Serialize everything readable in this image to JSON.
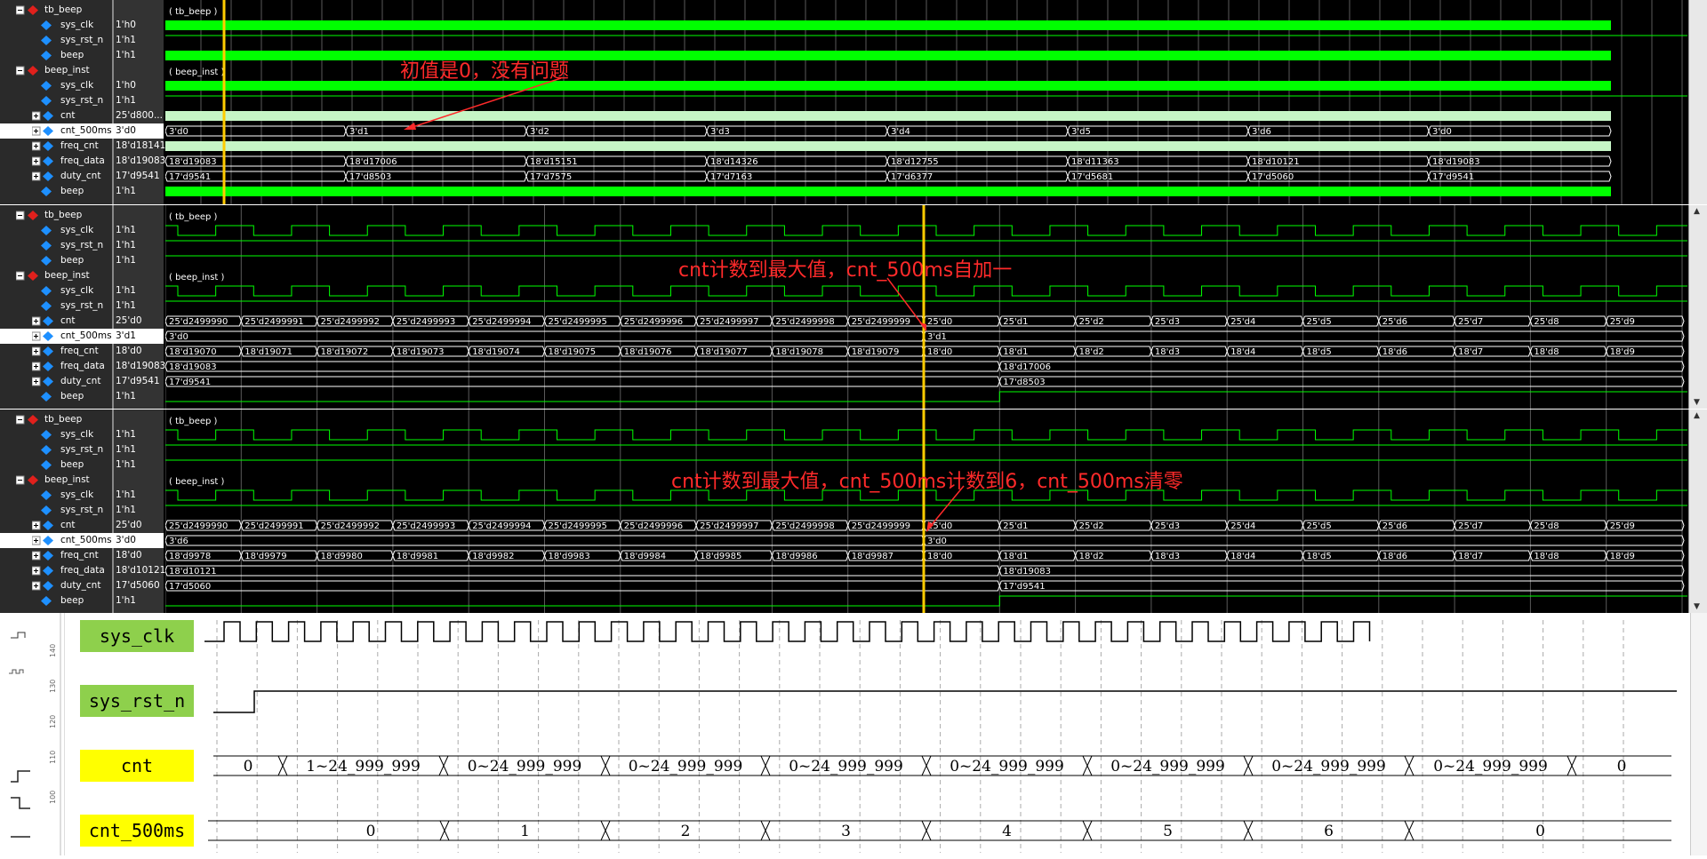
{
  "panes": [
    {
      "rows": [
        {
          "name": "tb_beep",
          "value": "",
          "level": 0,
          "kind": "group"
        },
        {
          "name": "sys_clk",
          "value": "1'h0",
          "level": 1,
          "kind": "sig"
        },
        {
          "name": "sys_rst_n",
          "value": "1'h1",
          "level": 1,
          "kind": "sig"
        },
        {
          "name": "beep",
          "value": "1'h1",
          "level": 1,
          "kind": "sig"
        },
        {
          "name": "beep_inst",
          "value": "",
          "level": 0,
          "kind": "group"
        },
        {
          "name": "sys_clk",
          "value": "1'h0",
          "level": 1,
          "kind": "sig"
        },
        {
          "name": "sys_rst_n",
          "value": "1'h1",
          "level": 1,
          "kind": "sig"
        },
        {
          "name": "cnt",
          "value": "25'd800...",
          "level": 1,
          "kind": "bus"
        },
        {
          "name": "cnt_500ms",
          "value": "3'd0",
          "level": 1,
          "kind": "bus",
          "selected": true
        },
        {
          "name": "freq_cnt",
          "value": "18'd18141",
          "level": 1,
          "kind": "bus"
        },
        {
          "name": "freq_data",
          "value": "18'd19083",
          "level": 1,
          "kind": "bus"
        },
        {
          "name": "duty_cnt",
          "value": "17'd9541",
          "level": 1,
          "kind": "bus"
        },
        {
          "name": "beep",
          "value": "1'h1",
          "level": 1,
          "kind": "sig"
        }
      ],
      "group_labels": [
        "( tb_beep )",
        "( beep_inst )"
      ],
      "cnt500_segments": [
        "3'd0",
        "3'd1",
        "3'd2",
        "3'd3",
        "3'd4",
        "3'd5",
        "3'd6",
        "3'd0"
      ],
      "freq_data_segments": [
        "18'd19083",
        "18'd17006",
        "18'd15151",
        "18'd14326",
        "18'd12755",
        "18'd11363",
        "18'd10121",
        "18'd19083"
      ],
      "duty_cnt_segments": [
        "17'd9541",
        "17'd8503",
        "17'd7575",
        "17'd7163",
        "17'd6377",
        "17'd5681",
        "17'd5060",
        "17'd9541"
      ],
      "annotation": "初值是0，没有问题"
    },
    {
      "rows": [
        {
          "name": "tb_beep",
          "value": "",
          "level": 0,
          "kind": "group"
        },
        {
          "name": "sys_clk",
          "value": "1'h1",
          "level": 1,
          "kind": "sig"
        },
        {
          "name": "sys_rst_n",
          "value": "1'h1",
          "level": 1,
          "kind": "sig"
        },
        {
          "name": "beep",
          "value": "1'h1",
          "level": 1,
          "kind": "sig"
        },
        {
          "name": "beep_inst",
          "value": "",
          "level": 0,
          "kind": "group"
        },
        {
          "name": "sys_clk",
          "value": "1'h1",
          "level": 1,
          "kind": "sig"
        },
        {
          "name": "sys_rst_n",
          "value": "1'h1",
          "level": 1,
          "kind": "sig"
        },
        {
          "name": "cnt",
          "value": "25'd0",
          "level": 1,
          "kind": "bus"
        },
        {
          "name": "cnt_500ms",
          "value": "3'd1",
          "level": 1,
          "kind": "bus",
          "selected": true
        },
        {
          "name": "freq_cnt",
          "value": "18'd0",
          "level": 1,
          "kind": "bus"
        },
        {
          "name": "freq_data",
          "value": "18'd19083",
          "level": 1,
          "kind": "bus"
        },
        {
          "name": "duty_cnt",
          "value": "17'd9541",
          "level": 1,
          "kind": "bus"
        },
        {
          "name": "beep",
          "value": "1'h1",
          "level": 1,
          "kind": "sig"
        }
      ],
      "group_labels": [
        "( tb_beep )",
        "( beep_inst )"
      ],
      "cnt_segments": [
        "25'd2499990",
        "25'd2499991",
        "25'd2499992",
        "25'd2499993",
        "25'd2499994",
        "25'd2499995",
        "25'd2499996",
        "25'd2499997",
        "25'd2499998",
        "25'd2499999",
        "25'd0",
        "25'd1",
        "25'd2",
        "25'd3",
        "25'd4",
        "25'd5",
        "25'd6",
        "25'd7",
        "25'd8",
        "25'd9"
      ],
      "cnt500_segments": [
        "3'd0",
        "3'd1"
      ],
      "freq_cnt_segments": [
        "18'd19070",
        "18'd19071",
        "18'd19072",
        "18'd19073",
        "18'd19074",
        "18'd19075",
        "18'd19076",
        "18'd19077",
        "18'd19078",
        "18'd19079",
        "18'd0",
        "18'd1",
        "18'd2",
        "18'd3",
        "18'd4",
        "18'd5",
        "18'd6",
        "18'd7",
        "18'd8",
        "18'd9"
      ],
      "freq_data_segments": [
        "18'd19083",
        "18'd17006"
      ],
      "duty_cnt_segments": [
        "17'd9541",
        "17'd8503"
      ],
      "annotation": "cnt计数到最大值，cnt_500ms自加一"
    },
    {
      "rows": [
        {
          "name": "tb_beep",
          "value": "",
          "level": 0,
          "kind": "group"
        },
        {
          "name": "sys_clk",
          "value": "1'h1",
          "level": 1,
          "kind": "sig"
        },
        {
          "name": "sys_rst_n",
          "value": "1'h1",
          "level": 1,
          "kind": "sig"
        },
        {
          "name": "beep",
          "value": "1'h1",
          "level": 1,
          "kind": "sig"
        },
        {
          "name": "beep_inst",
          "value": "",
          "level": 0,
          "kind": "group"
        },
        {
          "name": "sys_clk",
          "value": "1'h1",
          "level": 1,
          "kind": "sig"
        },
        {
          "name": "sys_rst_n",
          "value": "1'h1",
          "level": 1,
          "kind": "sig"
        },
        {
          "name": "cnt",
          "value": "25'd0",
          "level": 1,
          "kind": "bus"
        },
        {
          "name": "cnt_500ms",
          "value": "3'd0",
          "level": 1,
          "kind": "bus",
          "selected": true
        },
        {
          "name": "freq_cnt",
          "value": "18'd0",
          "level": 1,
          "kind": "bus"
        },
        {
          "name": "freq_data",
          "value": "18'd10121",
          "level": 1,
          "kind": "bus"
        },
        {
          "name": "duty_cnt",
          "value": "17'd5060",
          "level": 1,
          "kind": "bus"
        },
        {
          "name": "beep",
          "value": "1'h1",
          "level": 1,
          "kind": "sig"
        }
      ],
      "group_labels": [
        "( tb_beep )",
        "( beep_inst )"
      ],
      "cnt_segments": [
        "25'd2499990",
        "25'd2499991",
        "25'd2499992",
        "25'd2499993",
        "25'd2499994",
        "25'd2499995",
        "25'd2499996",
        "25'd2499997",
        "25'd2499998",
        "25'd2499999",
        "25'd0",
        "25'd1",
        "25'd2",
        "25'd3",
        "25'd4",
        "25'd5",
        "25'd6",
        "25'd7",
        "25'd8",
        "25'd9"
      ],
      "cnt500_segments": [
        "3'd6",
        "3'd0"
      ],
      "freq_cnt_segments": [
        "18'd9978",
        "18'd9979",
        "18'd9980",
        "18'd9981",
        "18'd9982",
        "18'd9983",
        "18'd9984",
        "18'd9985",
        "18'd9986",
        "18'd9987",
        "18'd0",
        "18'd1",
        "18'd2",
        "18'd3",
        "18'd4",
        "18'd5",
        "18'd6",
        "18'd7",
        "18'd8",
        "18'd9"
      ],
      "freq_data_segments": [
        "18'd10121",
        "18'd19083"
      ],
      "duty_cnt_segments": [
        "17'd5060",
        "17'd9541"
      ],
      "annotation": "cnt计数到最大值，cnt_500ms计数到6，cnt_500ms清零"
    }
  ],
  "timing": {
    "labels": [
      {
        "text": "sys_clk",
        "color": "green"
      },
      {
        "text": "sys_rst_n",
        "color": "green"
      },
      {
        "text": "cnt",
        "color": "yellow"
      },
      {
        "text": "cnt_500ms",
        "color": "yellow"
      }
    ],
    "cnt_values": [
      "0",
      "1~24_999_999",
      "0~24_999_999",
      "0~24_999_999",
      "0~24_999_999",
      "0~24_999_999",
      "0~24_999_999",
      "0~24_999_999",
      "0~24_999_999",
      "0"
    ],
    "cnt500_values": [
      "0",
      "1",
      "2",
      "3",
      "4",
      "5",
      "6",
      "0"
    ],
    "ruler_ticks": [
      "140",
      "130",
      "120",
      "110",
      "100"
    ]
  },
  "colors": {
    "wave": "#00ff00",
    "bus": "#ffffff",
    "cursor": "#ffcc00",
    "annotation": "#ff2a2a",
    "grid": "#5a5a5a"
  }
}
